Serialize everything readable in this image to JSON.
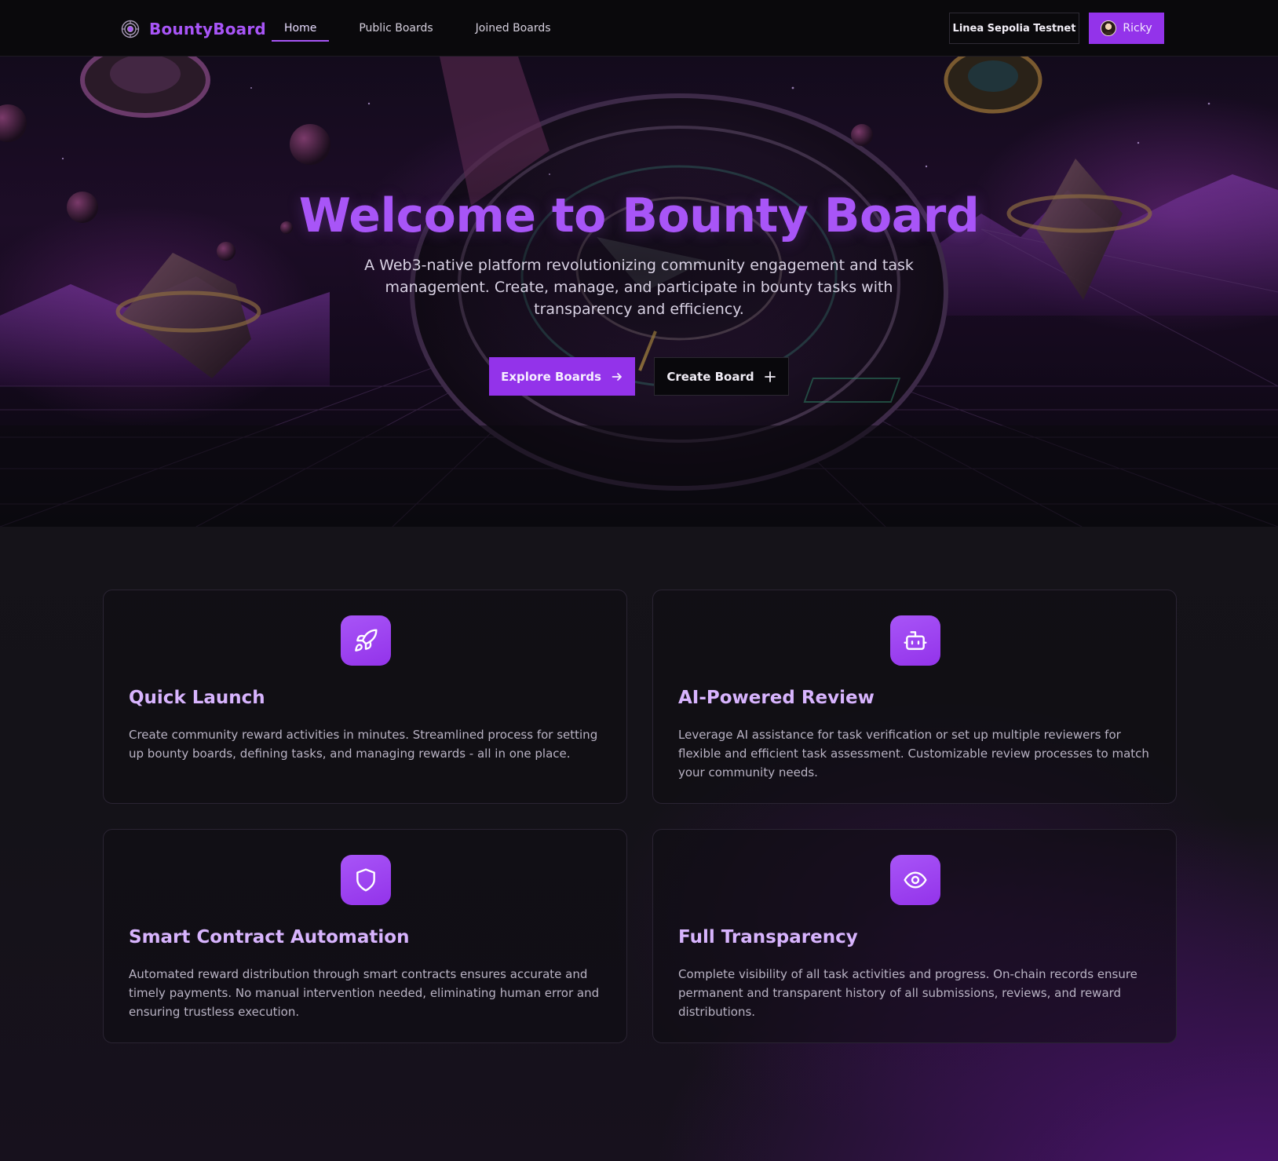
{
  "brand": {
    "name": "BountyBoard",
    "logo_icon": "target-icon",
    "accent": "#a855f7"
  },
  "nav": {
    "links": [
      {
        "label": "Home",
        "active": true
      },
      {
        "label": "Public Boards",
        "active": false
      },
      {
        "label": "Joined Boards",
        "active": false
      }
    ],
    "network_label": "Linea Sepolia Testnet",
    "user_label": "Ricky"
  },
  "hero": {
    "title": "Welcome to Bounty Board",
    "subtitle": "A Web3-native platform revolutionizing community engagement and task management. Create, manage, and participate in bounty tasks with transparency and efficiency.",
    "primary_cta": {
      "label": "Explore Boards",
      "icon": "arrow-right-icon"
    },
    "secondary_cta": {
      "label": "Create Board",
      "icon": "plus-icon"
    }
  },
  "features": [
    {
      "icon": "rocket-icon",
      "title": "Quick Launch",
      "description": "Create community reward activities in minutes. Streamlined process for setting up bounty boards, defining tasks, and managing rewards - all in one place."
    },
    {
      "icon": "bot-icon",
      "title": "AI-Powered Review",
      "description": "Leverage AI assistance for task verification or set up multiple reviewers for flexible and efficient task assessment. Customizable review processes to match your community needs."
    },
    {
      "icon": "shield-icon",
      "title": "Smart Contract Automation",
      "description": "Automated reward distribution through smart contracts ensures accurate and timely payments. No manual intervention needed, eliminating human error and ensuring trustless execution."
    },
    {
      "icon": "eye-icon",
      "title": "Full Transparency",
      "description": "Complete visibility of all task activities and progress. On-chain records ensure permanent and transparent history of all submissions, reviews, and reward distributions."
    }
  ],
  "colors": {
    "primary": "#9333ea",
    "accent_text": "#d8b4fe",
    "background": "#0d0b10"
  }
}
